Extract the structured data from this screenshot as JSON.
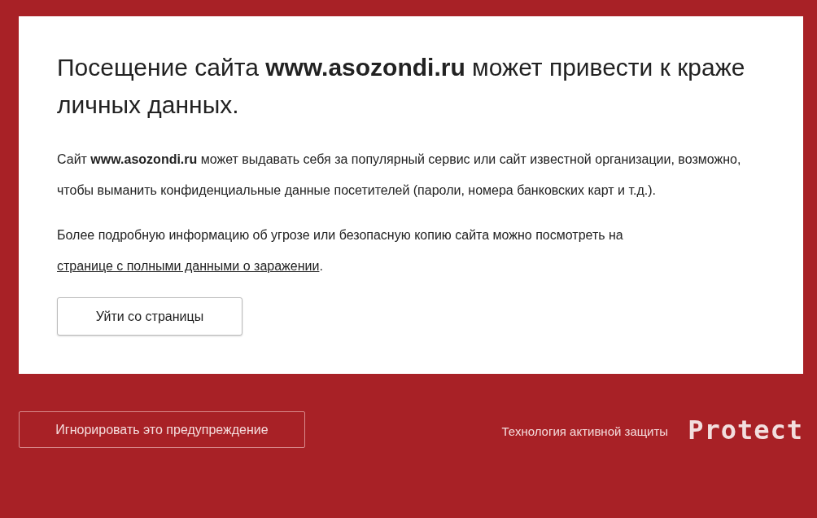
{
  "warning": {
    "title": "Посещение сайта **www.asozondi.ru** может привести к краже личных данных.",
    "description": "Сайт **www.asozondi.ru** может выдавать себя за популярный сервис или сайт известной организации, возможно, чтобы выманить конфиденциальные данные посетителей (пароли, номера банковских карт и т.д.).",
    "details": {
      "text_before": "Более подробную информацию об угрозе или безопасную копию сайта можно посмотреть на ",
      "link": "странице с полными данными о заражении",
      "text_after": "."
    },
    "leave_button": "Уйти со страницы"
  },
  "footer": {
    "ignore_button": "Игнорировать это предупреждение",
    "tagline": "Технология активной защиты",
    "logo": "Protect"
  }
}
